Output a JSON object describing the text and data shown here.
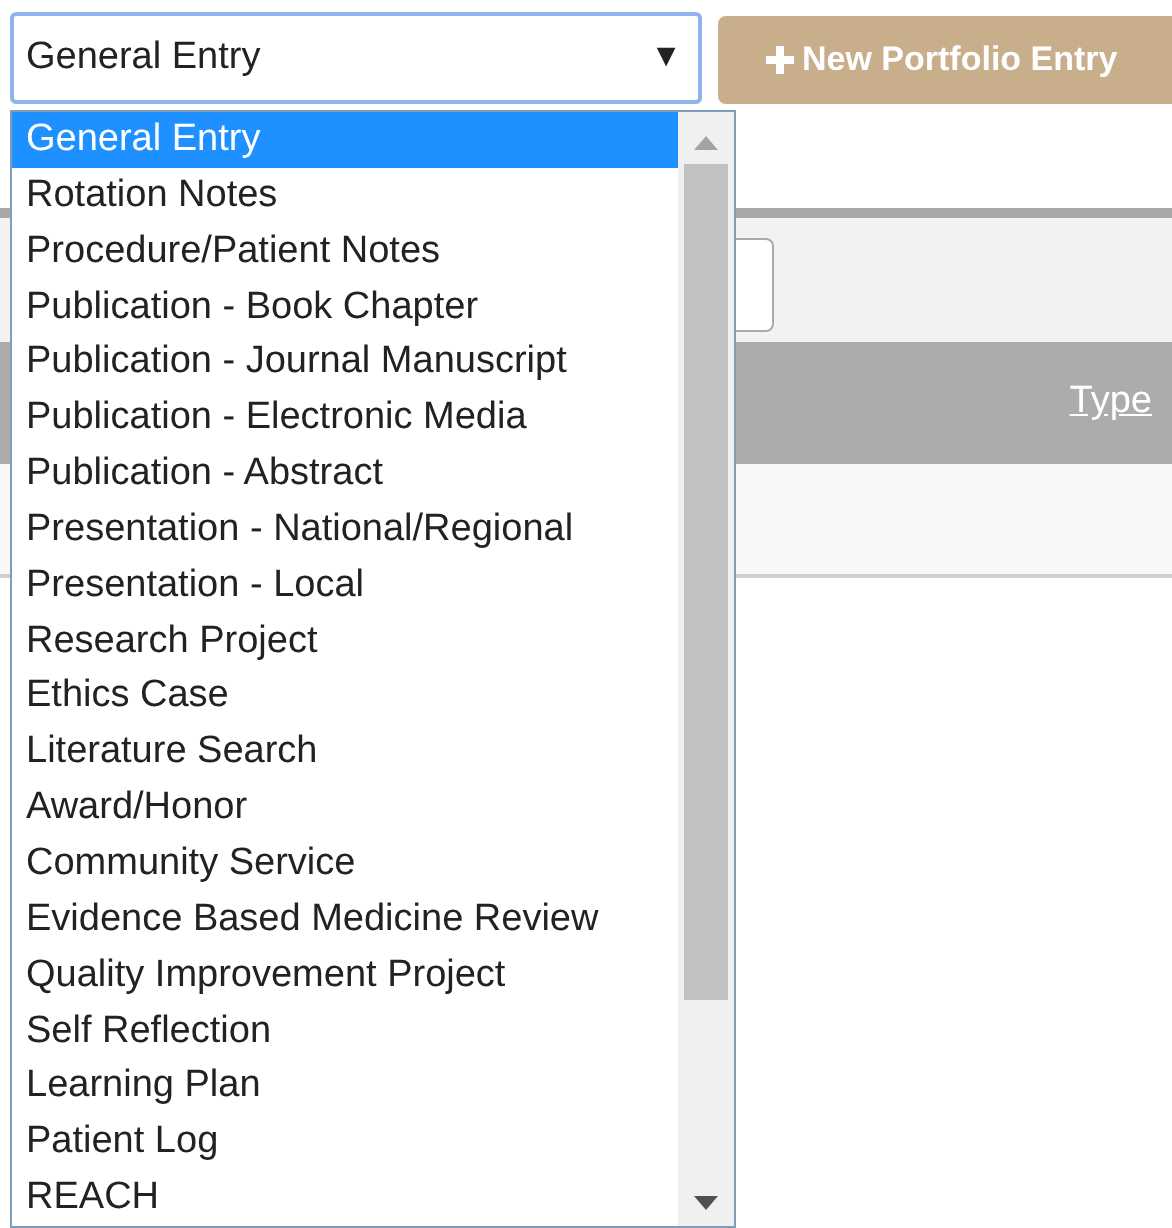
{
  "select": {
    "value": "General Entry",
    "arrow": "▼"
  },
  "new_button": {
    "label": "New Portfolio Entry"
  },
  "table": {
    "columns": [
      "Type"
    ]
  },
  "options": [
    {
      "label": "General Entry",
      "selected": true
    },
    {
      "label": "Rotation Notes",
      "selected": false
    },
    {
      "label": "Procedure/Patient Notes",
      "selected": false
    },
    {
      "label": "Publication - Book Chapter",
      "selected": false
    },
    {
      "label": "Publication - Journal Manuscript",
      "selected": false
    },
    {
      "label": "Publication - Electronic Media",
      "selected": false
    },
    {
      "label": "Publication - Abstract",
      "selected": false
    },
    {
      "label": "Presentation - National/Regional",
      "selected": false
    },
    {
      "label": "Presentation - Local",
      "selected": false
    },
    {
      "label": "Research Project",
      "selected": false
    },
    {
      "label": "Ethics Case",
      "selected": false
    },
    {
      "label": "Literature Search",
      "selected": false
    },
    {
      "label": "Award/Honor",
      "selected": false
    },
    {
      "label": "Community Service",
      "selected": false
    },
    {
      "label": "Evidence Based Medicine Review",
      "selected": false
    },
    {
      "label": "Quality Improvement Project",
      "selected": false
    },
    {
      "label": "Self Reflection",
      "selected": false
    },
    {
      "label": "Learning Plan",
      "selected": false
    },
    {
      "label": "Patient Log",
      "selected": false
    },
    {
      "label": "REACH",
      "selected": false
    }
  ]
}
